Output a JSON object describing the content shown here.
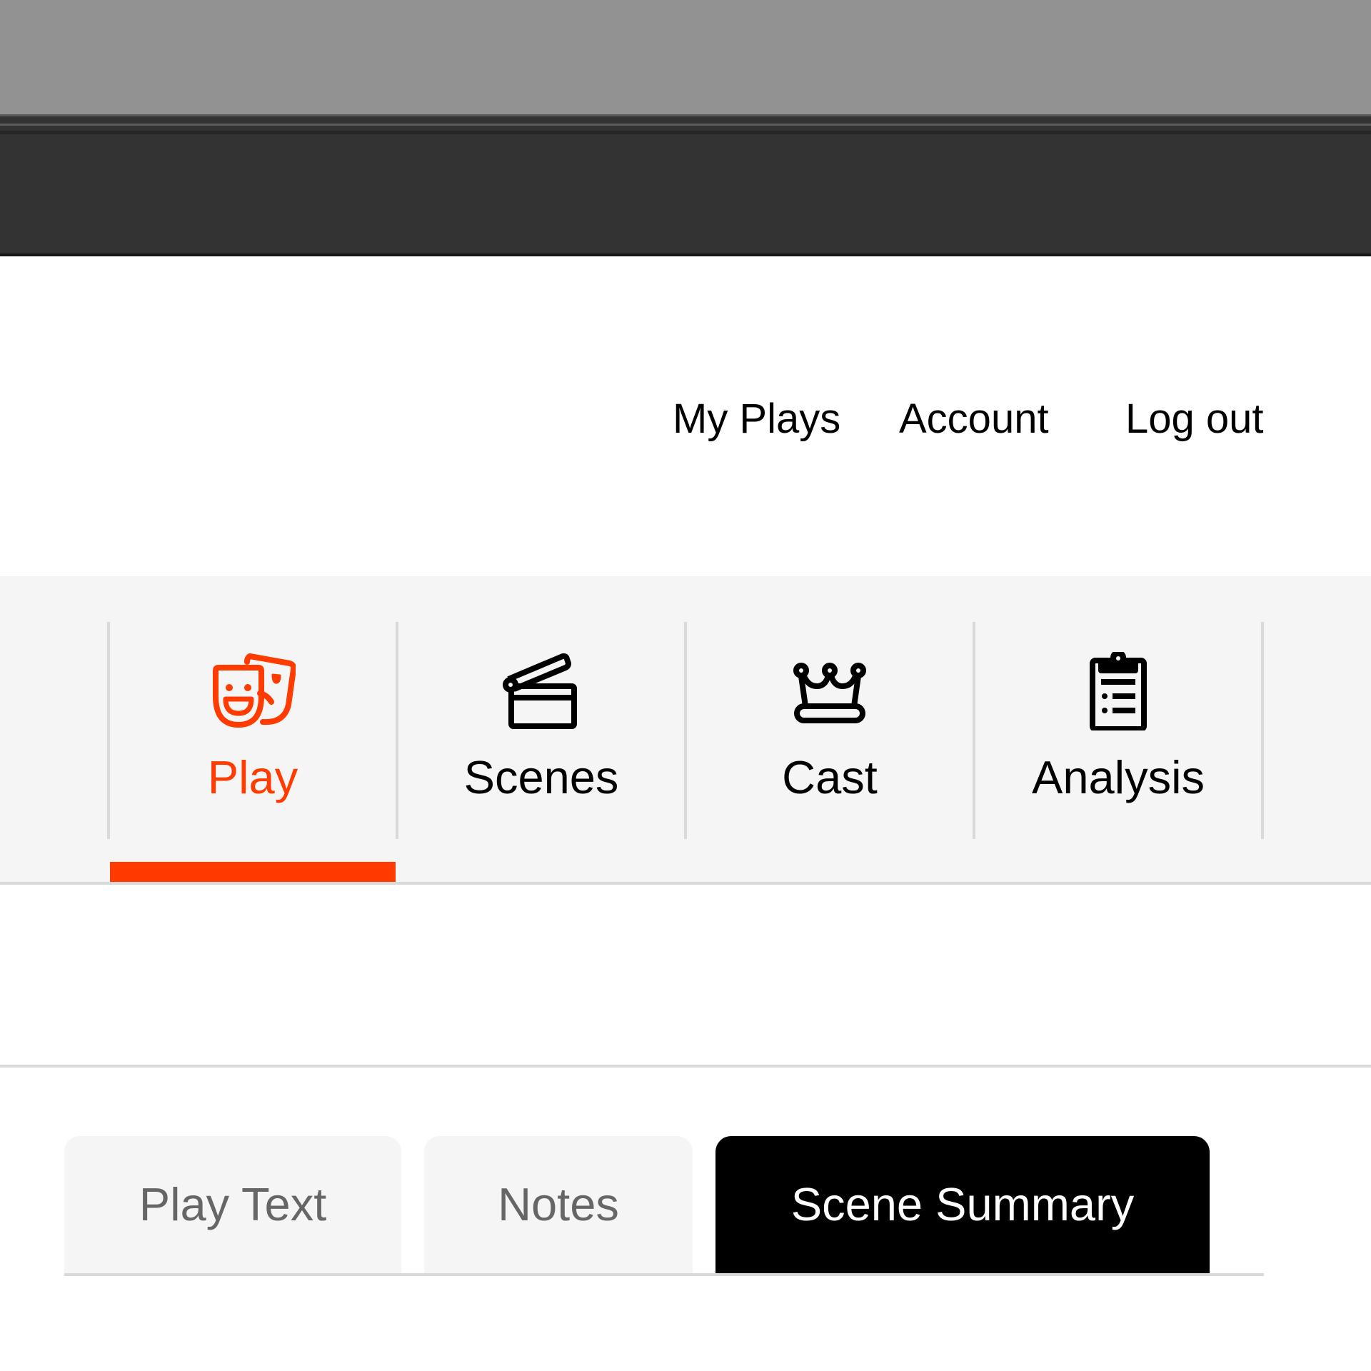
{
  "header": {
    "links": [
      {
        "label": "My Plays"
      },
      {
        "label": "Account"
      },
      {
        "label": "Log out"
      }
    ]
  },
  "main_nav": {
    "active_index": 0,
    "accent_color": "#ff3b00",
    "tabs": [
      {
        "label": "Play",
        "icon": "theater-masks-icon",
        "active": true
      },
      {
        "label": "Scenes",
        "icon": "clapperboard-icon",
        "active": false
      },
      {
        "label": "Cast",
        "icon": "crown-icon",
        "active": false
      },
      {
        "label": "Analysis",
        "icon": "clipboard-list-icon",
        "active": false
      }
    ]
  },
  "sub_tabs": {
    "tabs": [
      {
        "label": "Play Text",
        "active": false
      },
      {
        "label": "Notes",
        "active": false
      },
      {
        "label": "Scene Summary",
        "active": true
      }
    ]
  }
}
